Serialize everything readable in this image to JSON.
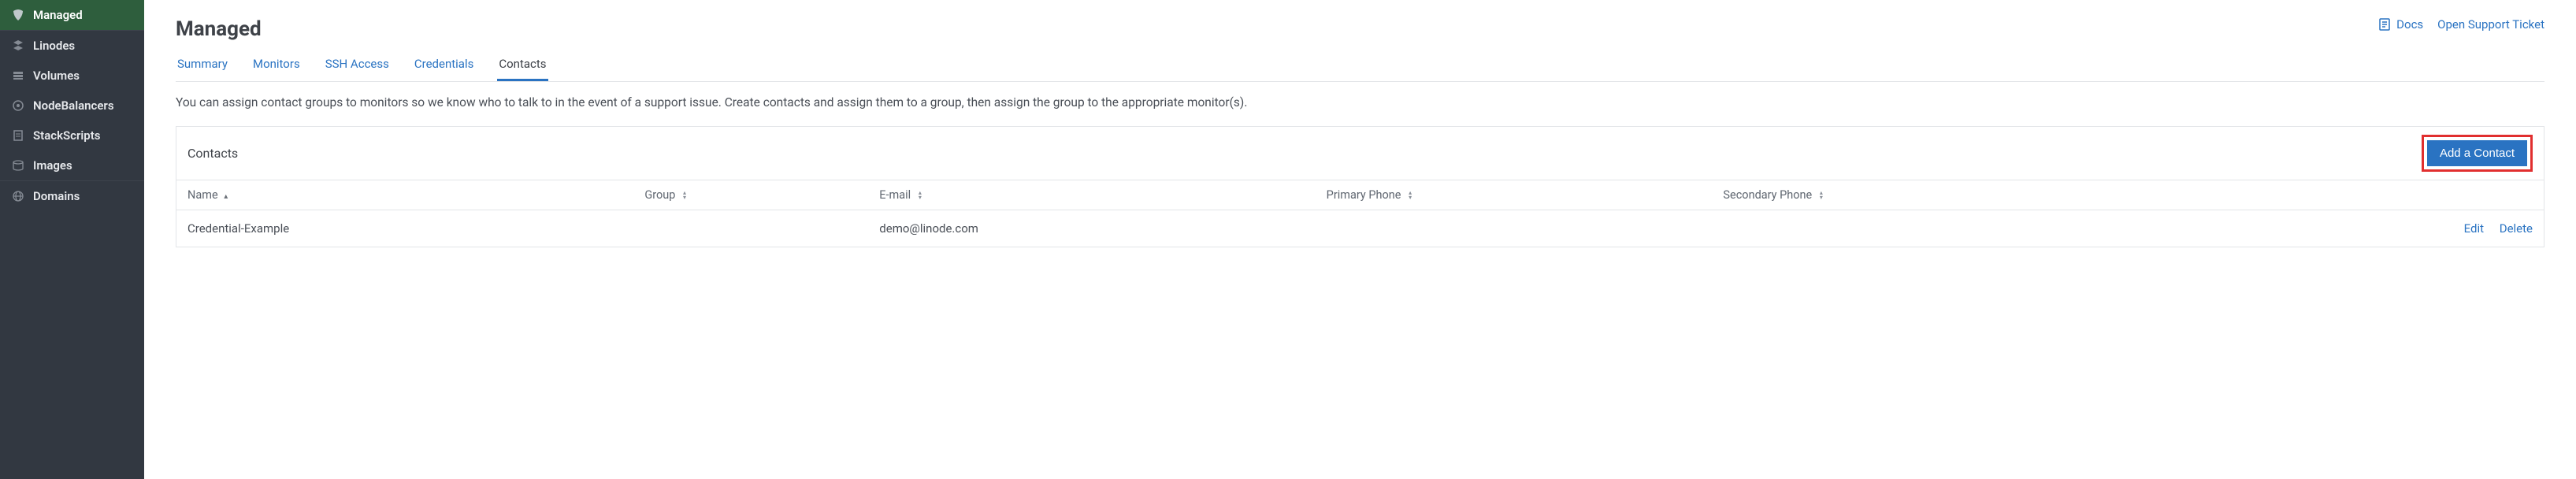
{
  "sidebar": {
    "items": [
      {
        "label": "Managed",
        "icon": "managed-icon",
        "active": true
      },
      {
        "label": "Linodes",
        "icon": "linodes-icon"
      },
      {
        "label": "Volumes",
        "icon": "volumes-icon"
      },
      {
        "label": "NodeBalancers",
        "icon": "nodebalancers-icon"
      },
      {
        "label": "StackScripts",
        "icon": "stackscripts-icon"
      },
      {
        "label": "Images",
        "icon": "images-icon"
      },
      {
        "label": "Domains",
        "icon": "domains-icon"
      }
    ]
  },
  "header": {
    "title": "Managed",
    "docs_label": "Docs",
    "support_label": "Open Support Ticket"
  },
  "tabs": [
    {
      "label": "Summary"
    },
    {
      "label": "Monitors"
    },
    {
      "label": "SSH Access"
    },
    {
      "label": "Credentials"
    },
    {
      "label": "Contacts",
      "active": true
    }
  ],
  "helptext": "You can assign contact groups to monitors so we know who to talk to in the event of a support issue. Create contacts and assign them to a group, then assign the group to the appropriate monitor(s).",
  "card": {
    "title": "Contacts",
    "add_button": "Add a Contact",
    "columns": {
      "name": "Name",
      "group": "Group",
      "email": "E-mail",
      "primary_phone": "Primary Phone",
      "secondary_phone": "Secondary Phone"
    },
    "rows": [
      {
        "name": "Credential-Example",
        "group": "",
        "email": "demo@linode.com",
        "primary_phone": "",
        "secondary_phone": "",
        "edit_label": "Edit",
        "delete_label": "Delete"
      }
    ]
  }
}
